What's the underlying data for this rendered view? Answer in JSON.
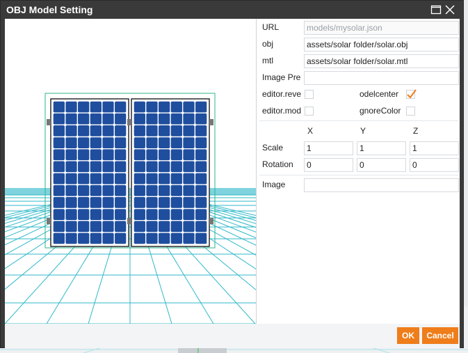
{
  "dialog": {
    "title": "OBJ Model Setting",
    "icons": {
      "maximize": "maximize-icon",
      "close": "close-icon"
    }
  },
  "fields": {
    "url": {
      "label": "URL",
      "value": "models/mysolar.json"
    },
    "obj": {
      "label": "obj",
      "value": "assets/solar folder/solar.obj"
    },
    "mtl": {
      "label": "mtl",
      "value": "assets/solar folder/solar.mtl"
    },
    "image_preview": {
      "label": "Image Pre",
      "value": ""
    }
  },
  "checkboxes": {
    "editor_reverse": {
      "label": "editor.reve",
      "checked": false
    },
    "model_center": {
      "label": "odelcenter",
      "checked": true
    },
    "editor_mode": {
      "label": "editor.mod",
      "checked": false
    },
    "ignore_color": {
      "label": "gnoreColor",
      "checked": false
    }
  },
  "transform": {
    "headers": {
      "x": "X",
      "y": "Y",
      "z": "Z"
    },
    "scale": {
      "label": "Scale",
      "x": "1",
      "y": "1",
      "z": "1"
    },
    "rotation": {
      "label": "Rotation",
      "x": "0",
      "y": "0",
      "z": "0"
    }
  },
  "image": {
    "label": "Image",
    "value": ""
  },
  "buttons": {
    "ok": "OK",
    "cancel": "Cancel"
  },
  "colors": {
    "title_bar": "#3a3a3a",
    "accent": "#ef7d1a",
    "grid": "#2fb8c9",
    "panel_blue": "#1f4e9e",
    "check_mark": "#ef7d1a"
  }
}
